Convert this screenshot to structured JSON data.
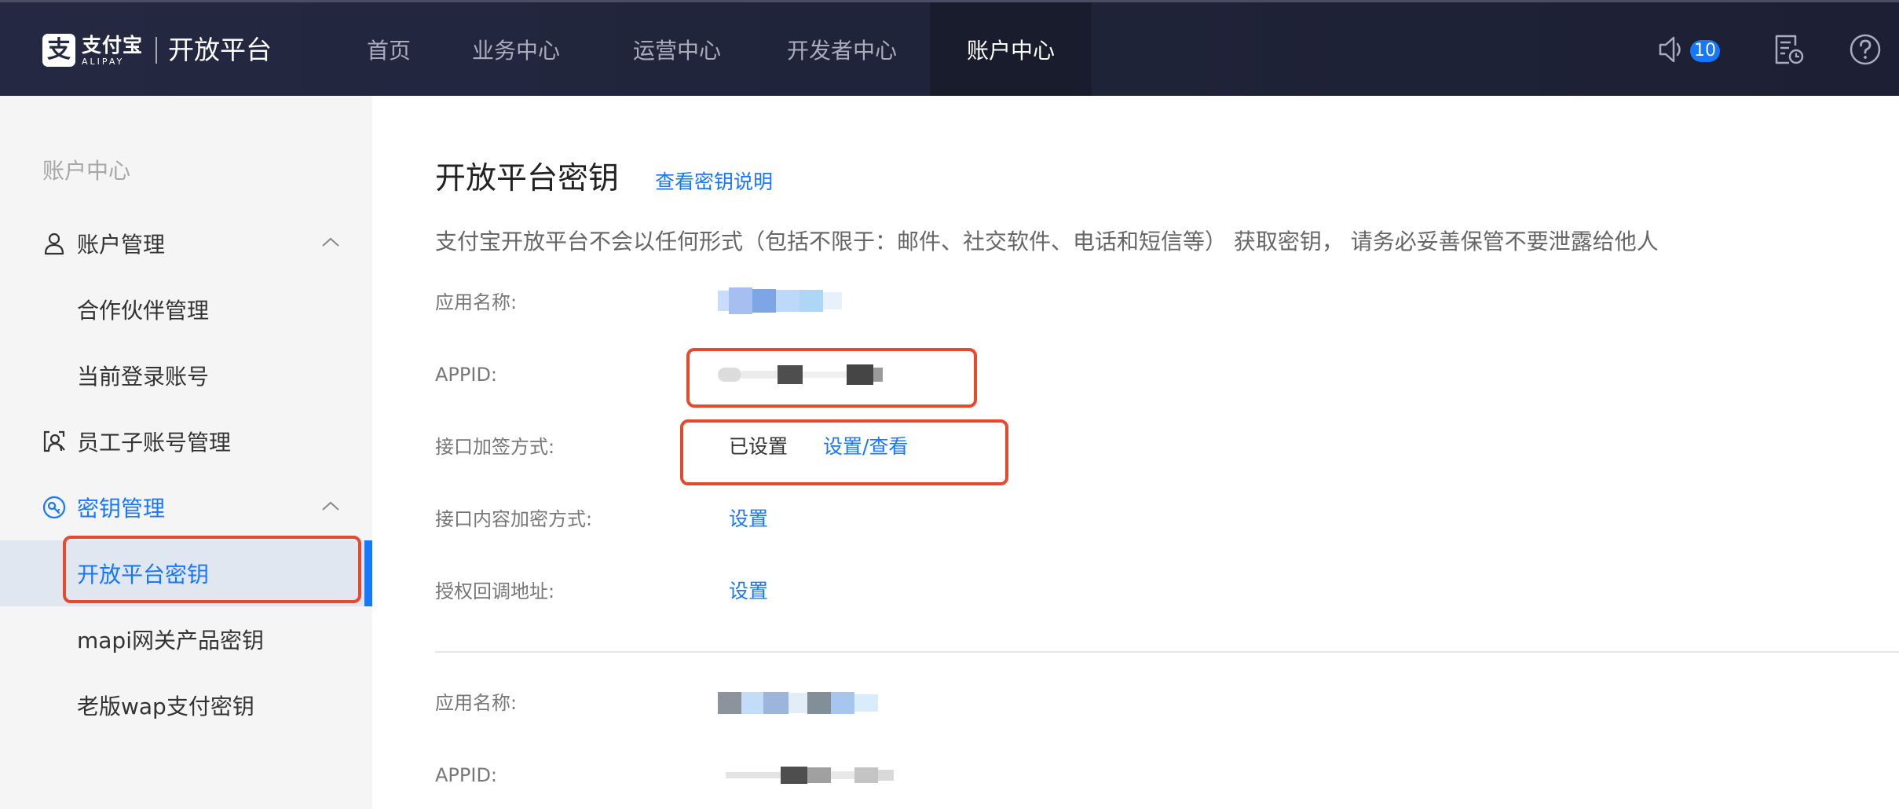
{
  "brand": {
    "logo_glyph": "支",
    "logo_cn": "支付宝",
    "logo_en": "ALIPAY",
    "title": "开放平台"
  },
  "nav": {
    "items": [
      {
        "label": "首页"
      },
      {
        "label": "业务中心"
      },
      {
        "label": "运营中心"
      },
      {
        "label": "开发者中心"
      },
      {
        "label": "账户中心",
        "active": true
      }
    ]
  },
  "toolbar": {
    "notification_icon": "speaker-icon",
    "notification_count": "10",
    "task_icon": "document-clock-icon",
    "help_icon": "help-circle-icon"
  },
  "sidebar": {
    "heading": "账户中心",
    "groups": [
      {
        "label": "账户管理",
        "icon": "user-icon",
        "expanded": true
      },
      {
        "label": "员工子账号管理",
        "icon": "staff-id-icon"
      },
      {
        "label": "密钥管理",
        "icon": "key-circle-icon",
        "expanded": true
      }
    ],
    "account_items": [
      "合作伙伴管理",
      "当前登录账号"
    ],
    "key_items": [
      "开放平台密钥",
      "mapi网关产品密钥",
      "老版wap支付密钥"
    ]
  },
  "main": {
    "title": "开放平台密钥",
    "title_link": "查看密钥说明",
    "notice": "支付宝开放平台不会以任何形式（包括不限于：邮件、社交软件、电话和短信等） 获取密钥， 请务必妥善保管不要泄露给他人",
    "app1": {
      "name_label": "应用名称:",
      "appid_label": "APPID:",
      "sign_label": "接口加签方式:",
      "sign_status": "已设置",
      "sign_link": "设置/查看",
      "encrypt_label": "接口内容加密方式:",
      "encrypt_link": "设置",
      "callback_label": "授权回调地址:",
      "callback_link": "设置"
    },
    "app2": {
      "name_label": "应用名称:",
      "appid_label": "APPID:"
    }
  },
  "colors": {
    "accent": "#1677ff",
    "highlight_border": "#e8482b",
    "topbar": "#242842"
  }
}
